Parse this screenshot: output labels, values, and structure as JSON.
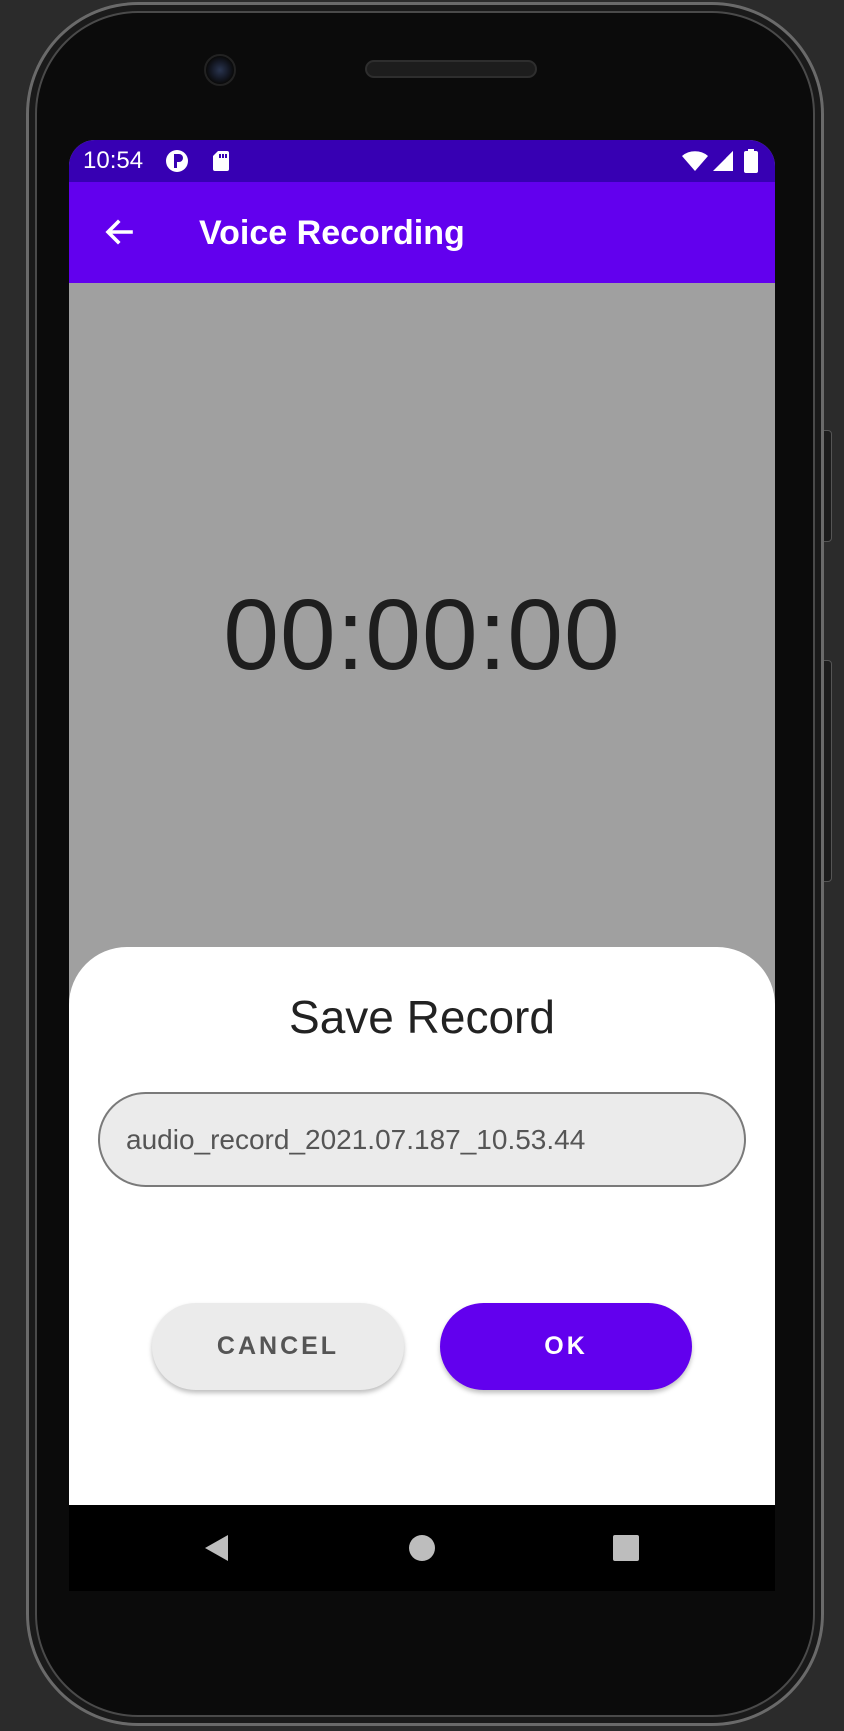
{
  "status_bar": {
    "time": "10:54",
    "icons": [
      "notification-p-icon",
      "sd-card-icon",
      "wifi-icon",
      "signal-icon",
      "battery-icon"
    ]
  },
  "app_bar": {
    "title": "Voice Recording",
    "back_icon": "arrow-left-icon",
    "color": "#6200ee",
    "status_color": "#3700b3"
  },
  "recorder": {
    "timer": "00:00:00"
  },
  "dialog": {
    "title": "Save Record",
    "filename_value": "audio_record_2021.07.187_10.53.44",
    "cancel_label": "CANCEL",
    "ok_label": "OK"
  },
  "nav_bar": {
    "back_icon": "nav-back-icon",
    "home_icon": "nav-home-icon",
    "recents_icon": "nav-recents-icon"
  }
}
